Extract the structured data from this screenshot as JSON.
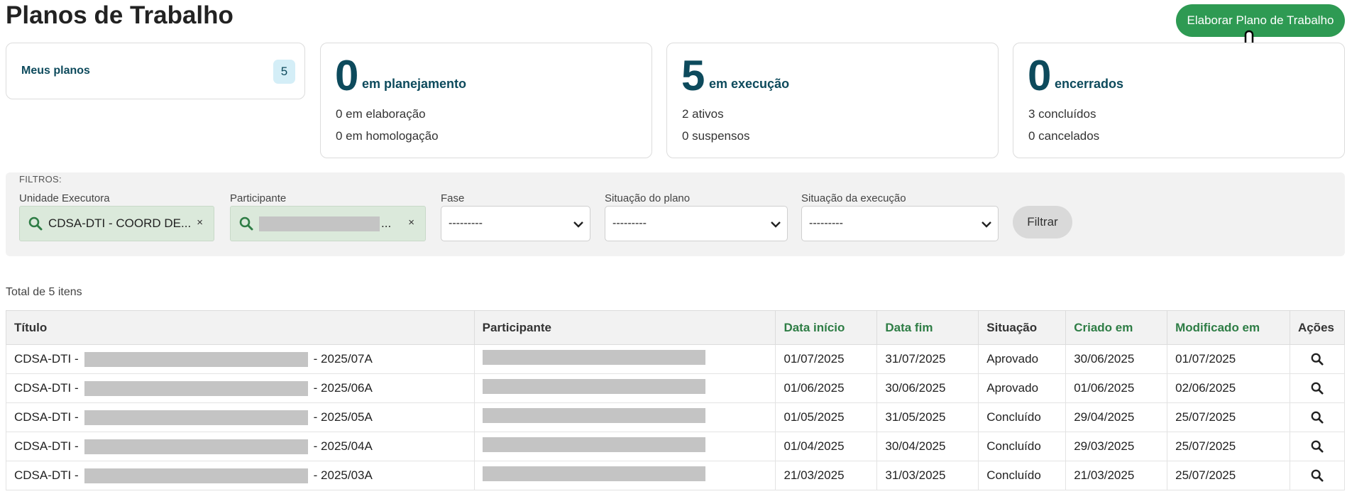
{
  "page": {
    "title": "Planos de Trabalho",
    "primary_action": "Elaborar Plano de Trabalho"
  },
  "summary": {
    "my_plans": {
      "label": "Meus planos",
      "count": "5"
    },
    "cards": [
      {
        "number": "0",
        "label": "em planejamento",
        "line1": "0 em elaboração",
        "line2": "0 em homologação"
      },
      {
        "number": "5",
        "label": "em execução",
        "line1": "2 ativos",
        "line2": "0 suspensos"
      },
      {
        "number": "0",
        "label": "encerrados",
        "line1": "3 concluídos",
        "line2": "0 cancelados"
      }
    ]
  },
  "filters": {
    "title": "FILTROS:",
    "unidade": {
      "label": "Unidade Executora",
      "value": "CDSA-DTI - COORD DE..."
    },
    "participante": {
      "label": "Participante",
      "suffix": "..."
    },
    "fase": {
      "label": "Fase",
      "value": "---------"
    },
    "situacao_plano": {
      "label": "Situação do plano",
      "value": "---------"
    },
    "situacao_execucao": {
      "label": "Situação da execução",
      "value": "---------"
    },
    "clear_symbol": "×",
    "submit": "Filtrar"
  },
  "table": {
    "total_label": "Total de 5 itens",
    "columns": [
      "Título",
      "Participante",
      "Data início",
      "Data fim",
      "Situação",
      "Criado em",
      "Modificado em",
      "Ações"
    ],
    "rows": [
      {
        "title_prefix": "CDSA-DTI -",
        "title_suffix": "- 2025/07A",
        "start": "01/07/2025",
        "end": "31/07/2025",
        "status": "Aprovado",
        "created": "30/06/2025",
        "modified": "01/07/2025"
      },
      {
        "title_prefix": "CDSA-DTI -",
        "title_suffix": "- 2025/06A",
        "start": "01/06/2025",
        "end": "30/06/2025",
        "status": "Aprovado",
        "created": "01/06/2025",
        "modified": "02/06/2025"
      },
      {
        "title_prefix": "CDSA-DTI -",
        "title_suffix": "- 2025/05A",
        "start": "01/05/2025",
        "end": "31/05/2025",
        "status": "Concluído",
        "created": "29/04/2025",
        "modified": "25/07/2025"
      },
      {
        "title_prefix": "CDSA-DTI -",
        "title_suffix": "- 2025/04A",
        "start": "01/04/2025",
        "end": "30/04/2025",
        "status": "Concluído",
        "created": "29/03/2025",
        "modified": "25/07/2025"
      },
      {
        "title_prefix": "CDSA-DTI -",
        "title_suffix": "- 2025/03A",
        "start": "21/03/2025",
        "end": "31/03/2025",
        "status": "Concluído",
        "created": "21/03/2025",
        "modified": "25/07/2025"
      }
    ]
  },
  "icons": {
    "search": "search-icon",
    "chevron": "chevron-down-icon",
    "pointer": "hand-pointer-icon"
  },
  "colors": {
    "primary": "#2e9a53",
    "heading": "#0d4a5c",
    "badge_bg": "#d4eef7",
    "filter_active_bg": "#dbe9db",
    "sortable_header": "#2e7d45"
  }
}
